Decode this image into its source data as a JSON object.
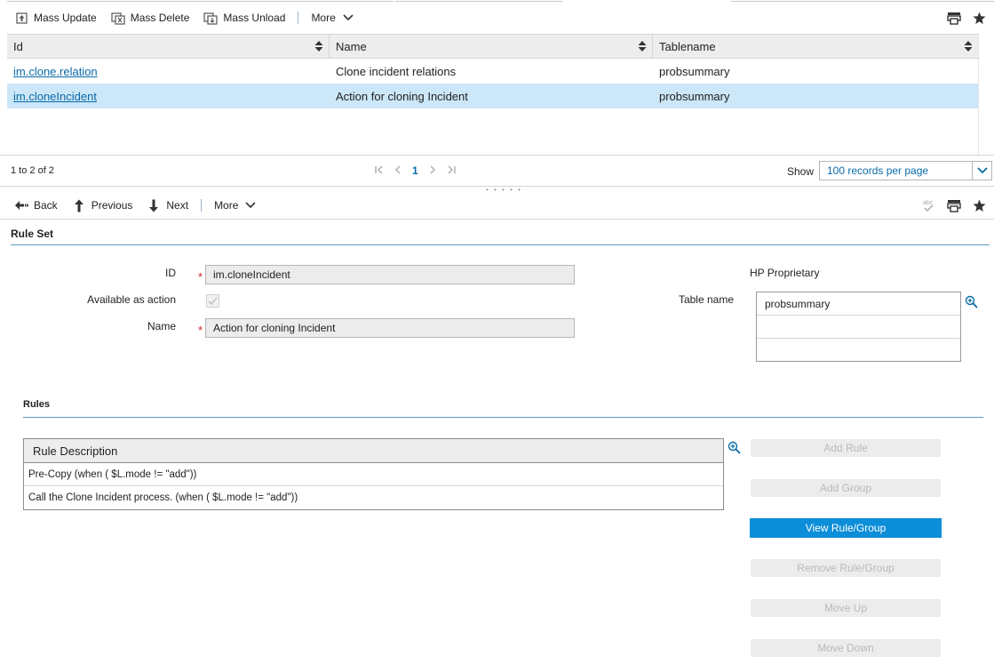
{
  "top_toolbar": {
    "mass_update": "Mass Update",
    "mass_delete": "Mass Delete",
    "mass_unload": "Mass Unload",
    "more": "More"
  },
  "grid": {
    "columns": [
      "Id",
      "Name",
      "Tablename"
    ],
    "rows": [
      {
        "id": "im.clone.relation",
        "name": "Clone incident relations",
        "tablename": "probsummary"
      },
      {
        "id": "im.cloneIncident",
        "name": "Action for cloning Incident",
        "tablename": "probsummary"
      }
    ]
  },
  "pager": {
    "count": "1 to 2 of 2",
    "current_page": "1",
    "show_label": "Show",
    "per_page": "100 records per page"
  },
  "detail_toolbar": {
    "back": "Back",
    "previous": "Previous",
    "next": "Next",
    "more": "More"
  },
  "form": {
    "section_title": "Rule Set",
    "id_label": "ID",
    "id_value": "im.cloneIncident",
    "available_label": "Available as action",
    "name_label": "Name",
    "name_value": "Action for cloning Incident",
    "hp_proprietary": "HP Proprietary",
    "table_name_label": "Table name",
    "table_names": [
      "probsummary",
      "",
      ""
    ]
  },
  "rules": {
    "section_title": "Rules",
    "header": "Rule Description",
    "items": [
      "Pre-Copy (when ( $L.mode != \"add\"))",
      "Call the Clone Incident process. (when ( $L.mode != \"add\"))"
    ],
    "buttons": {
      "add_rule": "Add Rule",
      "add_group": "Add Group",
      "view": "View Rule/Group",
      "remove": "Remove Rule/Group",
      "move_up": "Move Up",
      "move_down": "Move Down"
    }
  },
  "colors": {
    "accent": "#0d8ed8",
    "selected_row": "#cce7f7",
    "link": "#0a6aa8",
    "required": "#d02020"
  }
}
